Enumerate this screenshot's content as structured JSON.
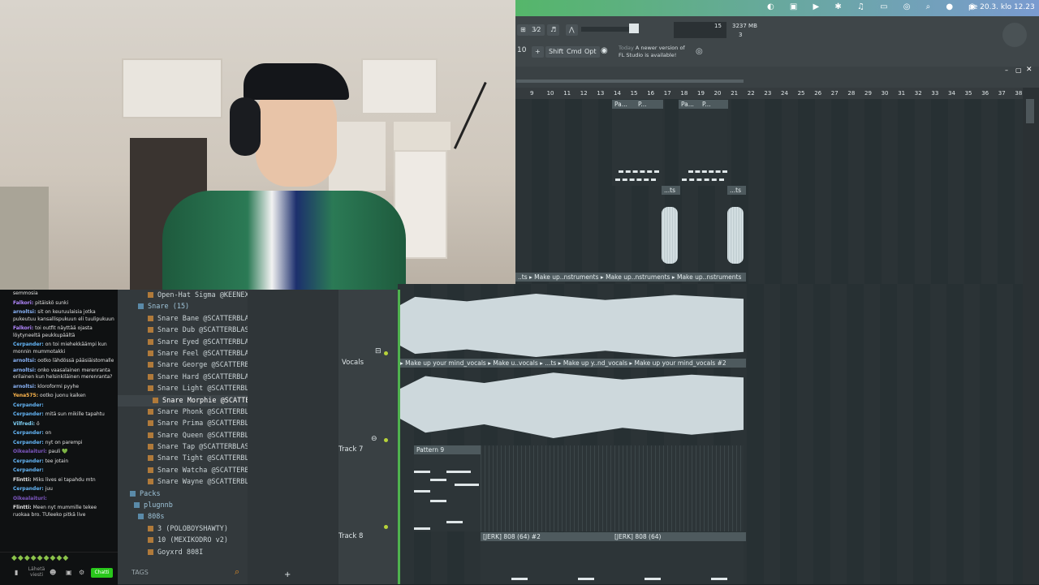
{
  "system_bar": {
    "clock": "pe 20.3. klo 12.23",
    "icons": [
      "creative-cloud-icon",
      "screen-record-icon",
      "play-icon",
      "bluetooth-icon",
      "headphones-icon",
      "battery-icon",
      "wifi-icon",
      "search-icon",
      "user-icon",
      "siri-icon"
    ]
  },
  "toolbar": {
    "cpu": "15",
    "memory": "3237 MB",
    "voices": "3",
    "pattern_number": "10",
    "plus": "+",
    "shift": "Shift",
    "cmd": "Cmd",
    "opt": "Opt",
    "hint_day": "Today",
    "hint_text": "A newer version of",
    "hint_text2": "FL Studio is available!"
  },
  "ruler": [
    "9",
    "10",
    "11",
    "12",
    "13",
    "14",
    "15",
    "16",
    "17",
    "18",
    "19",
    "20",
    "21",
    "22",
    "23",
    "24",
    "25",
    "26",
    "27",
    "28",
    "29",
    "30",
    "31",
    "32",
    "33",
    "34",
    "35",
    "36",
    "37",
    "38"
  ],
  "clips": {
    "pa1": "Pa...",
    "p1": "P...",
    "pa2": "Pa...",
    "p2": "P...",
    "ts1": "...ts",
    "ts2": "...ts",
    "inst_row": "..ts ▸ Make up..nstruments ▸ Make up..nstruments ▸ Make up..nstruments",
    "vocals_row": "▸ Make up your mind_vocals ▸ Make u..vocals ▸ ...ts ▸ Make up y..nd_vocals ▸ Make up your mind_vocals #2",
    "pattern9": "Pattern 9",
    "808a": "[JERK] 808 (64) #2",
    "808b": "[JERK] 808 (64)"
  },
  "tracks": {
    "vocals": "Vocals",
    "track7": "Track 7",
    "track8": "Track 8"
  },
  "browser": {
    "items": [
      {
        "label": "Open-Hat Sigma @KEENEX",
        "type": "file"
      },
      {
        "label": "Snare (15)",
        "type": "folder"
      },
      {
        "label": "Snare Bane  @SCATTERBLAST",
        "type": "file"
      },
      {
        "label": "Snare Dub  @SCATTERBLAST",
        "type": "file"
      },
      {
        "label": "Snare Eyed  @SCATTERBLAST",
        "type": "file"
      },
      {
        "label": "Snare Feel  @SCATTERBLAST",
        "type": "file"
      },
      {
        "label": "Snare George  @SCATTERBLAST",
        "type": "file"
      },
      {
        "label": "Snare Hard  @SCATTERBLAST",
        "type": "file"
      },
      {
        "label": "Snare Light  @SCATTERBLAST",
        "type": "file"
      },
      {
        "label": "Snare Morphie  @SCATTERBLAST",
        "type": "selected"
      },
      {
        "label": "Snare Phonk  @SCATTERBLAST",
        "type": "file"
      },
      {
        "label": "Snare Prima  @SCATTERBLAST",
        "type": "file"
      },
      {
        "label": "Snare Queen  @SCATTERBLAST",
        "type": "file"
      },
      {
        "label": "Snare Tap  @SCATTERBLAST",
        "type": "file"
      },
      {
        "label": "Snare Tight  @SCATTERBLAST",
        "type": "file"
      },
      {
        "label": "Snare Watcha  @SCATTERBLAST",
        "type": "file"
      },
      {
        "label": "Snare Wayne  @SCATTERBLAST",
        "type": "file"
      },
      {
        "label": "Packs",
        "type": "folder"
      },
      {
        "label": "plugnnb",
        "type": "folder"
      },
      {
        "label": "808s",
        "type": "folder"
      },
      {
        "label": "3 (POLOBOYSHAWTY)",
        "type": "file"
      },
      {
        "label": "10 (MEXIKODRO v2)",
        "type": "file"
      },
      {
        "label": "Goyxrd 808I",
        "type": "file"
      }
    ],
    "tags": "TAGS"
  },
  "chat": {
    "messages": [
      {
        "user": "",
        "text": "semmosia",
        "color": "#e0e0e0"
      },
      {
        "user": "Falkori:",
        "text": "pitäiskö sunki",
        "color": "#b388ff"
      },
      {
        "user": "arnoltsi:",
        "text": "sit on keuruulaisia jotka pukeutuu kansallispukuun eli tuulipukuun",
        "color": "#8ab4f8"
      },
      {
        "user": "Falkori:",
        "text": "toi outfit näyttää ojasta löytyneeltä peukkupäältä",
        "color": "#b388ff"
      },
      {
        "user": "Cerpander:",
        "text": "on toi miehekkäämpi kun monnin mummotakki",
        "color": "#64b5f6"
      },
      {
        "user": "arnoltsi:",
        "text": "ootko lähdössä pääsiäistomalle",
        "color": "#8ab4f8"
      },
      {
        "user": "arnoltsi:",
        "text": "onko vaasalainen merenranta erilainen kun helsinkiläinen merenranta?",
        "color": "#8ab4f8"
      },
      {
        "user": "arnoltsi:",
        "text": "kloroformi pyyhe",
        "color": "#8ab4f8"
      },
      {
        "user": "Yena575:",
        "text": "ootko juonu kaiken",
        "color": "#ffb74d"
      },
      {
        "user": "Cerpander:",
        "text": "",
        "color": "#64b5f6"
      },
      {
        "user": "Cerpander:",
        "text": "mitä sun mikille tapahtu",
        "color": "#64b5f6"
      },
      {
        "user": "Vilfredi:",
        "text": "ö",
        "color": "#81d4fa"
      },
      {
        "user": "Cerpander:",
        "text": "on",
        "color": "#64b5f6"
      },
      {
        "user": "Cerpander:",
        "text": "nyt on parempi",
        "color": "#64b5f6"
      },
      {
        "user": "Oikealaituri:",
        "text": "pauli 💚",
        "color": "#7e57c2"
      },
      {
        "user": "Cerpander:",
        "text": "tee jotain",
        "color": "#64b5f6"
      },
      {
        "user": "Cerpander:",
        "text": "",
        "color": "#64b5f6"
      },
      {
        "user": "Flintti:",
        "text": "Miks lives ei tapahdu mtn",
        "color": "#e0e0e0"
      },
      {
        "user": "Cerpander:",
        "text": "juu",
        "color": "#64b5f6"
      },
      {
        "user": "Oikealaituri:",
        "text": "",
        "color": "#7e57c2"
      },
      {
        "user": "Flintti:",
        "text": "Meen nyt mummille tekee ruokaa bro. TUleeko pitkä live",
        "color": "#e0e0e0"
      }
    ],
    "send_label": "Lähetä viesti",
    "chat_button": "Chatti"
  }
}
